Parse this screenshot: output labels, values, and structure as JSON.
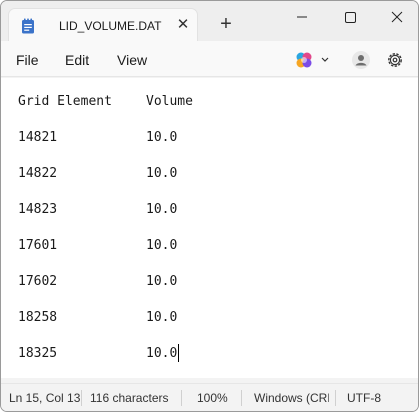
{
  "tab": {
    "title": "LID_VOLUME.DAT",
    "close_glyph": "✕",
    "new_tab_glyph": "+"
  },
  "menu": {
    "file": "File",
    "edit": "Edit",
    "view": "View"
  },
  "editor": {
    "header": {
      "col1": "Grid Element",
      "col2": "Volume"
    },
    "rows": [
      {
        "element": "14821",
        "volume": "10.0"
      },
      {
        "element": "14822",
        "volume": "10.0"
      },
      {
        "element": "14823",
        "volume": "10.0"
      },
      {
        "element": "17601",
        "volume": "10.0"
      },
      {
        "element": "17602",
        "volume": "10.0"
      },
      {
        "element": "18258",
        "volume": "10.0"
      },
      {
        "element": "18325",
        "volume": "10.0"
      }
    ]
  },
  "status": {
    "position": "Ln 15, Col 13",
    "characters": "116 characters",
    "zoom": "100%",
    "line_ending": "Windows (CRLF)",
    "encoding": "UTF-8"
  },
  "colors": {
    "accent": "#3d6fd8",
    "icon": "#3b73c9"
  },
  "icons": [
    "notepad-icon",
    "minimize-icon",
    "maximize-icon",
    "close-icon",
    "copilot-icon",
    "account-icon",
    "settings-icon"
  ]
}
